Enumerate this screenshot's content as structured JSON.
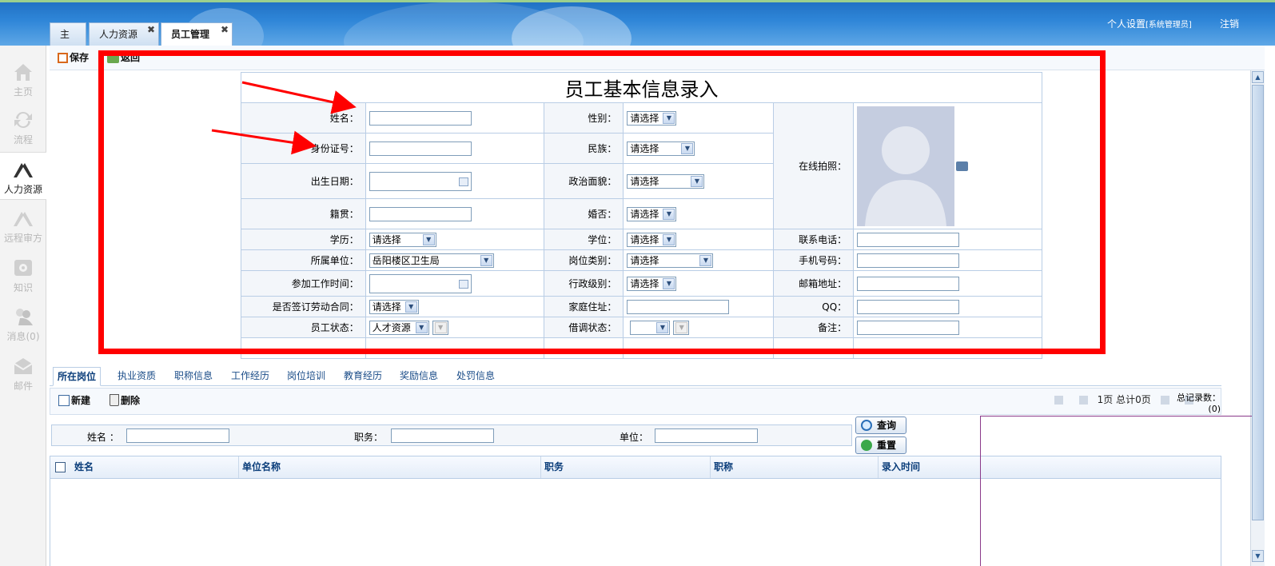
{
  "header": {
    "tabs": [
      {
        "label": "主页"
      },
      {
        "label": "人力资源"
      },
      {
        "label": "员工管理",
        "active": true
      }
    ],
    "tab_close": "✖",
    "settings": "个人设置",
    "settings_role": "[系统管理员]",
    "logout": "注销"
  },
  "leftnav": {
    "items": [
      {
        "label": "主页",
        "icon": "home-icon"
      },
      {
        "label": "流程",
        "icon": "flow-icon"
      },
      {
        "label": "人力资源",
        "icon": "hr-icon",
        "active": true
      },
      {
        "label": "远程审方",
        "icon": "remote-review-icon"
      },
      {
        "label": "知识",
        "icon": "knowledge-icon"
      },
      {
        "label": "消息(0)",
        "icon": "message-icon"
      },
      {
        "label": "邮件",
        "icon": "mail-icon"
      }
    ]
  },
  "toolbar": {
    "save": "保存",
    "back": "返回"
  },
  "form": {
    "title": "员工基本信息录入",
    "name_label": "姓名：",
    "id_label": "身份证号：",
    "birth_label": "出生日期：",
    "native_label": "籍贯：",
    "gender_label": "性别：",
    "gender_value": "请选择",
    "ethnic_label": "民族：",
    "ethnic_value": "请选择",
    "political_label": "政治面貌：",
    "political_value": "请选择",
    "marital_label": "婚否：",
    "marital_value": "请选择",
    "photo_label": "在线拍照：",
    "education_label": "学历：",
    "education_value": "请选择",
    "degree_label": "学位：",
    "degree_value": "请选择",
    "phone_label": "联系电话：",
    "unit_label": "所属单位：",
    "unit_value": "岳阳楼区卫生局",
    "post_type_label": "岗位类别：",
    "post_type_value": "请选择",
    "mobile_label": "手机号码：",
    "work_start_label": "参加工作时间：",
    "admin_level_label": "行政级别：",
    "admin_level_value": "请选择",
    "email_label": "邮箱地址：",
    "contract_label": "是否签订劳动合同：",
    "contract_value": "请选择",
    "address_label": "家庭住址：",
    "qq_label": "QQ：",
    "status_label": "员工状态：",
    "status_value": "人才资源",
    "secondment_label": "借调状态：",
    "secondment_value": "",
    "remark_label": "备注："
  },
  "subtabs": [
    "所在岗位",
    "执业资质",
    "职称信息",
    "工作经历",
    "岗位培训",
    "教育经历",
    "奖励信息",
    "处罚信息"
  ],
  "grid_toolbar": {
    "new": "新建",
    "delete": "删除",
    "page": "1页",
    "total_pages": "总计0页",
    "total_records_label": "总记录数：",
    "total_records": "(0)"
  },
  "search": {
    "name_label": "姓名 ：",
    "duty_label": "职务：",
    "unit_label": "单位：",
    "query": "查询",
    "reset": "重置"
  },
  "grid": {
    "columns": [
      "姓名",
      "单位名称",
      "职务",
      "职称",
      "录入时间"
    ]
  },
  "colors": {
    "accent": "#2f86d8",
    "annotation": "#ff0000"
  }
}
